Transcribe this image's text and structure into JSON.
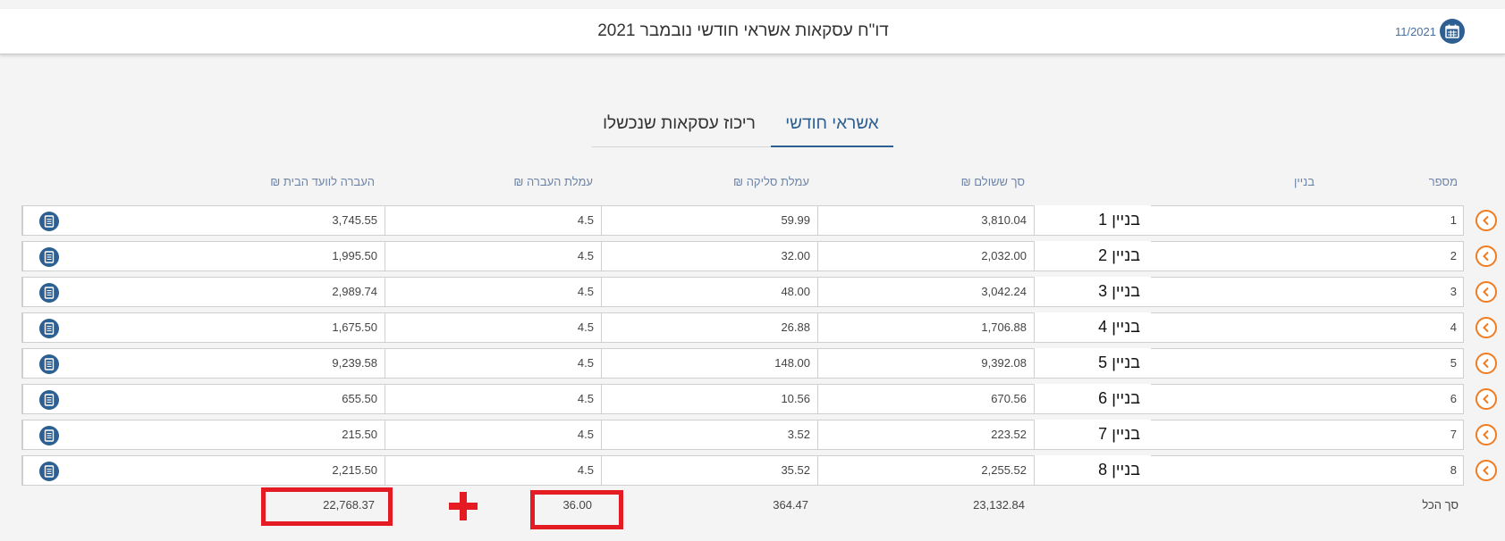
{
  "header": {
    "title": "דו\"ח עסקאות אשראי חודשי נובמבר 2021",
    "period": "11/2021",
    "period_icon": "calendar-icon"
  },
  "tabs": [
    {
      "label": "אשראי חודשי",
      "active": true
    },
    {
      "label": "ריכוז עסקאות שנכשלו",
      "active": false
    }
  ],
  "table": {
    "headers": {
      "number": "מספר",
      "building": "בניין",
      "total_paid": "סך ששולם ₪",
      "clearing_fee": "עמלת סליקה ₪",
      "transfer_fee": "עמלת העברה ₪",
      "transfer_to_committee": "העברה לוועד הבית ₪"
    },
    "rows": [
      {
        "number": "1",
        "building": "בניין 1",
        "total_paid": "3,810.04",
        "clearing_fee": "59.99",
        "transfer_fee": "4.5",
        "transfer_to_committee": "3,745.55"
      },
      {
        "number": "2",
        "building": "בניין 2",
        "total_paid": "2,032.00",
        "clearing_fee": "32.00",
        "transfer_fee": "4.5",
        "transfer_to_committee": "1,995.50"
      },
      {
        "number": "3",
        "building": "בניין 3",
        "total_paid": "3,042.24",
        "clearing_fee": "48.00",
        "transfer_fee": "4.5",
        "transfer_to_committee": "2,989.74"
      },
      {
        "number": "4",
        "building": "בניין 4",
        "total_paid": "1,706.88",
        "clearing_fee": "26.88",
        "transfer_fee": "4.5",
        "transfer_to_committee": "1,675.50"
      },
      {
        "number": "5",
        "building": "בניין 5",
        "total_paid": "9,392.08",
        "clearing_fee": "148.00",
        "transfer_fee": "4.5",
        "transfer_to_committee": "9,239.58"
      },
      {
        "number": "6",
        "building": "בניין 6",
        "total_paid": "670.56",
        "clearing_fee": "10.56",
        "transfer_fee": "4.5",
        "transfer_to_committee": "655.50"
      },
      {
        "number": "7",
        "building": "בניין 7",
        "total_paid": "223.52",
        "clearing_fee": "3.52",
        "transfer_fee": "4.5",
        "transfer_to_committee": "215.50"
      },
      {
        "number": "8",
        "building": "בניין 8",
        "total_paid": "2,255.52",
        "clearing_fee": "35.52",
        "transfer_fee": "4.5",
        "transfer_to_committee": "2,215.50"
      }
    ],
    "row_actions": {
      "expand_icon": "chevron-left-icon",
      "document_icon": "document-icon"
    },
    "totals": {
      "label": "סך הכל",
      "total_paid": "23,132.84",
      "clearing_fee": "364.47",
      "transfer_fee": "36.00",
      "transfer_to_committee": "22,768.37"
    }
  },
  "annotation": {
    "color": "#e51b23",
    "symbol": "plus-icon"
  },
  "colors": {
    "accent": "#2d5f91",
    "arrow": "#f07c21",
    "highlight": "#e51b23"
  }
}
